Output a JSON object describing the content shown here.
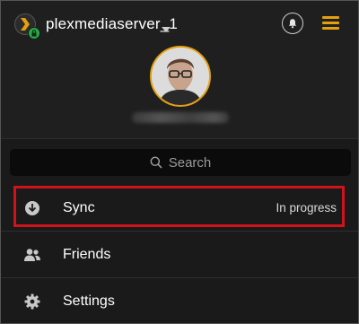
{
  "header": {
    "server_name": "plexmediaserver_1",
    "icons": {
      "server_logo": "plex-chevron-logo",
      "lock": "lock-icon",
      "caret": "chevron-down-icon",
      "bell": "bell-icon",
      "menu": "hamburger-menu-icon",
      "avatar": "user-avatar"
    }
  },
  "search": {
    "placeholder": "Search",
    "icon": "search-icon"
  },
  "menu": {
    "items": [
      {
        "label": "Sync",
        "status": "In progress",
        "icon": "download-circle-icon",
        "highlighted": true
      },
      {
        "label": "Friends",
        "icon": "friends-icon"
      },
      {
        "label": "Settings",
        "icon": "gear-icon"
      }
    ]
  },
  "colors": {
    "background": "#1f1f1f",
    "panel": "#1a1a1a",
    "accent": "#e5a00d",
    "highlight_outline": "#d0121b",
    "lock_badge": "#28a745"
  }
}
